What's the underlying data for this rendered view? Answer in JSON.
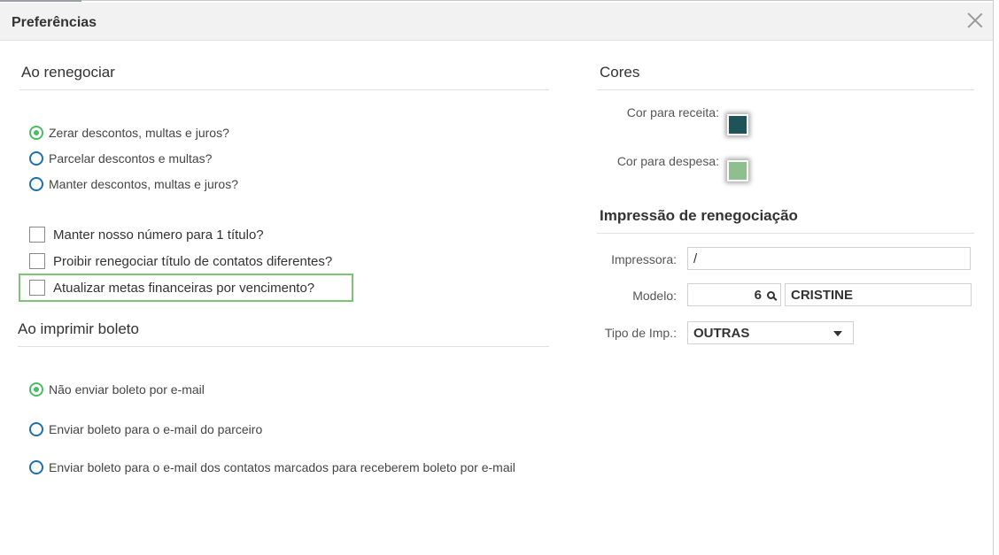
{
  "window": {
    "title": "Preferências"
  },
  "renegociar": {
    "title": "Ao renegociar",
    "radios": [
      {
        "label": "Zerar descontos, multas e juros?",
        "checked": true
      },
      {
        "label": "Parcelar descontos e multas?",
        "checked": false
      },
      {
        "label": "Manter descontos, multas e juros?",
        "checked": false
      }
    ],
    "checkboxes": [
      {
        "label": "Manter nosso número para 1 título?",
        "checked": false
      },
      {
        "label": "Proibir renegociar título de contatos diferentes?",
        "checked": false
      },
      {
        "label": "Atualizar metas financeiras por vencimento?",
        "checked": false
      }
    ]
  },
  "boleto": {
    "title": "Ao imprimir boleto",
    "radios": [
      {
        "label": "Não enviar boleto por e-mail",
        "checked": true
      },
      {
        "label": "Enviar boleto para o e-mail do parceiro",
        "checked": false
      },
      {
        "label": "Enviar boleto para o e-mail dos contatos marcados para receberem boleto por e-mail",
        "checked": false
      }
    ]
  },
  "cores": {
    "title": "Cores",
    "receita_label": "Cor para receita:",
    "receita_color": "#1e5457",
    "despesa_label": "Cor para despesa:",
    "despesa_color": "#8fbf8e"
  },
  "impressao": {
    "title": "Impressão de renegociação",
    "impressora_label": "Impressora:",
    "impressora_value": "/",
    "modelo_label": "Modelo:",
    "modelo_code": "6",
    "modelo_name": "CRISTINE",
    "tipo_label": "Tipo de Imp.:",
    "tipo_value": "OUTRAS"
  },
  "colors": {
    "accent_green": "#4cbb66",
    "radio_blue": "#1f6fa8",
    "highlight": "#7cc576"
  }
}
